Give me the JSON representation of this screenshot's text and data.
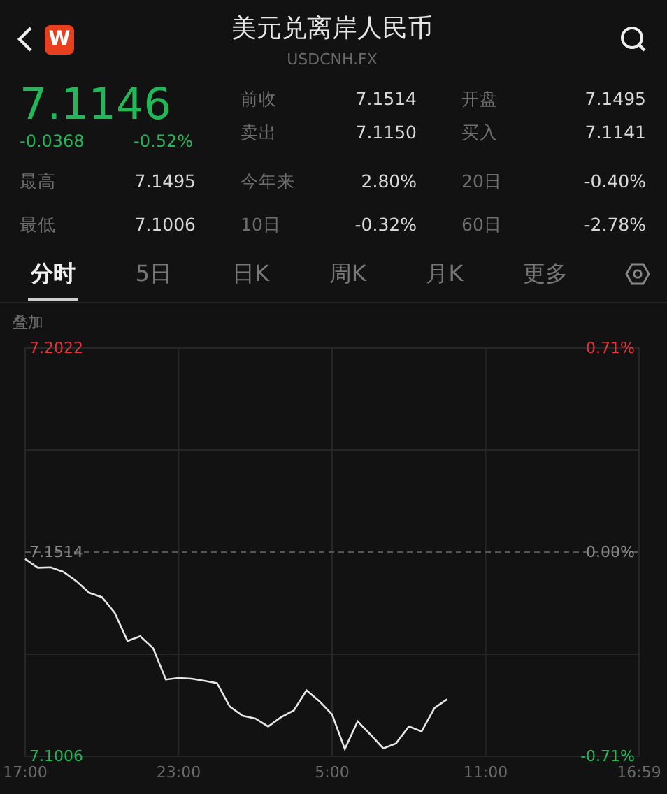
{
  "header": {
    "logo": "W",
    "title": "美元兑离岸人民币",
    "subtitle": "USDCNH.FX"
  },
  "quote": {
    "price": "7.1146",
    "change": "-0.0368",
    "change_pct": "-0.52%",
    "color": "#22b85a"
  },
  "quote_stats": [
    [
      {
        "label": "前收",
        "value": "7.1514"
      },
      {
        "label": "开盘",
        "value": "7.1495"
      }
    ],
    [
      {
        "label": "卖出",
        "value": "7.1150"
      },
      {
        "label": "买入",
        "value": "7.1141"
      }
    ]
  ],
  "range_stats": [
    [
      {
        "label": "最高",
        "value": "7.1495"
      },
      {
        "label": "今年来",
        "value": "2.80%"
      },
      {
        "label": "20日",
        "value": "-0.40%"
      }
    ],
    [
      {
        "label": "最低",
        "value": "7.1006"
      },
      {
        "label": "10日",
        "value": "-0.32%"
      },
      {
        "label": "60日",
        "value": "-2.78%"
      }
    ]
  ],
  "tabs": [
    {
      "label": "分时",
      "selected": true
    },
    {
      "label": "5日",
      "selected": false
    },
    {
      "label": "日K",
      "selected": false
    },
    {
      "label": "周K",
      "selected": false
    },
    {
      "label": "月K",
      "selected": false
    },
    {
      "label": "更多",
      "selected": false
    }
  ],
  "overlay_label": "叠加",
  "chart": {
    "percent_labels": [
      {
        "label": "0.71%",
        "color": "#e5343a"
      },
      {
        "label": "0.00%",
        "color": "#8a8a8a"
      },
      {
        "label": "-0.71%",
        "color": "#22b85a"
      }
    ],
    "chart_data": {
      "type": "line",
      "grid": true,
      "ref_lines": [
        {
          "axis": "y",
          "value": 7.1514
        }
      ],
      "ylim": [
        7.1006,
        7.2022
      ],
      "yticks": [
        {
          "value": 7.2022,
          "label": "7.2022"
        },
        {
          "value": 7.1514,
          "label": "7.1514"
        },
        {
          "value": 7.1006,
          "label": "7.1006"
        }
      ],
      "categories": [
        "17:00",
        null,
        null,
        null,
        null,
        null,
        null,
        null,
        null,
        null,
        null,
        null,
        "23:00",
        null,
        null,
        null,
        null,
        null,
        null,
        null,
        null,
        null,
        null,
        null,
        "5:00",
        null,
        null,
        null,
        null,
        null,
        null,
        null,
        null,
        null,
        null,
        null,
        "11:00",
        null,
        null,
        null,
        null,
        null,
        null,
        null,
        null,
        null,
        null,
        null,
        "16:59"
      ],
      "series": [
        {
          "color": "#e6e6e6",
          "values": [
            7.1497,
            7.1475,
            7.1476,
            7.1465,
            7.1442,
            7.1413,
            7.1402,
            7.1363,
            7.1293,
            7.1305,
            7.1275,
            7.1197,
            7.1201,
            7.1199,
            7.1194,
            7.1188,
            7.113,
            7.1107,
            7.11,
            7.108,
            7.1103,
            7.112,
            7.117,
            7.1143,
            7.111,
            7.1024,
            7.1093,
            7.106,
            7.1026,
            7.1038,
            7.108,
            7.1068,
            7.1126,
            7.1148,
            null,
            null,
            null,
            null,
            null,
            null,
            null,
            null,
            null,
            null,
            null,
            null,
            null,
            null,
            null
          ]
        }
      ]
    }
  }
}
